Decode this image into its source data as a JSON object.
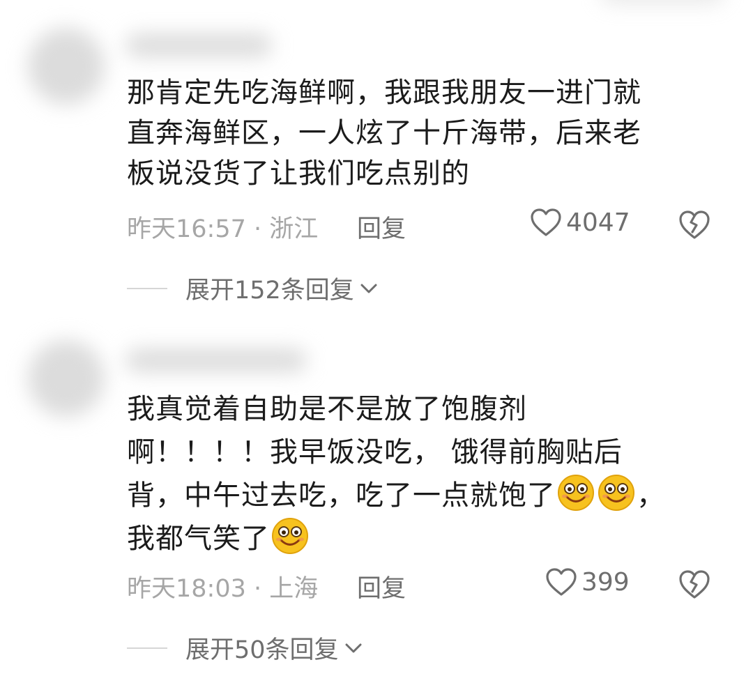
{
  "comments": [
    {
      "lines": [
        "那肯定先吃海鲜啊，我跟我朋友一进门就",
        "直奔海鲜区，一人炫了十斤海带，后来老",
        "板说没货了让我们吃点别的"
      ],
      "meta": "昨天16:57 · 浙江",
      "reply_label": "回复",
      "likes": "4047",
      "expand_label": "展开152条回复"
    },
    {
      "lines": [
        "我真觉着自助是不是放了饱腹剂",
        "啊！！！！我早饭没吃， 饿得前胸贴后",
        "背，中午过去吃，吃了一点就饱了",
        "，",
        "我都气笑了"
      ],
      "meta": "昨天18:03 · 上海",
      "reply_label": "回复",
      "likes": "399",
      "expand_label": "展开50条回复"
    }
  ],
  "icons": {
    "like": "heart-outline-icon",
    "dislike": "broken-heart-icon",
    "expand": "chevron-down-icon",
    "emoji": "smile-emoji-icon"
  },
  "colors": {
    "meta": "#a6a6a6",
    "action": "#6e6e6e",
    "text": "#1b1b1b"
  }
}
